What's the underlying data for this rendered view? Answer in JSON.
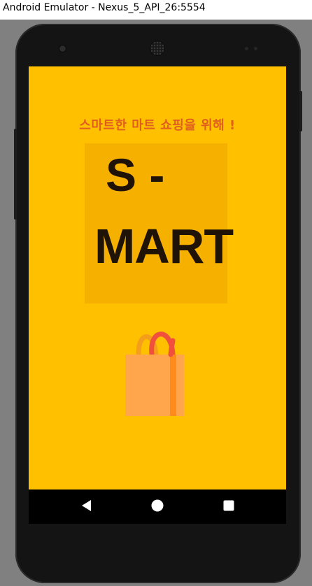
{
  "window": {
    "title": "Android Emulator - Nexus_5_API_26:5554"
  },
  "app": {
    "tagline": "스마트한 마트 쇼핑을 위해 !",
    "logo_line1": "S -",
    "logo_line2": "MART",
    "logo_icon": "shopping-bag-icon"
  },
  "navbar": {
    "back_icon": "back-triangle-icon",
    "home_icon": "home-circle-icon",
    "recents_icon": "recents-square-icon"
  },
  "colors": {
    "screen_background": "#ffc000",
    "logo_box": "#f5b000",
    "tagline": "#e05f1f",
    "logo_text": "#1f1206",
    "bag_body": "#ffa64d",
    "bag_stripe": "#ff8c1a",
    "bag_handle_front": "#f0503c",
    "bag_handle_back": "#f59e1b"
  }
}
